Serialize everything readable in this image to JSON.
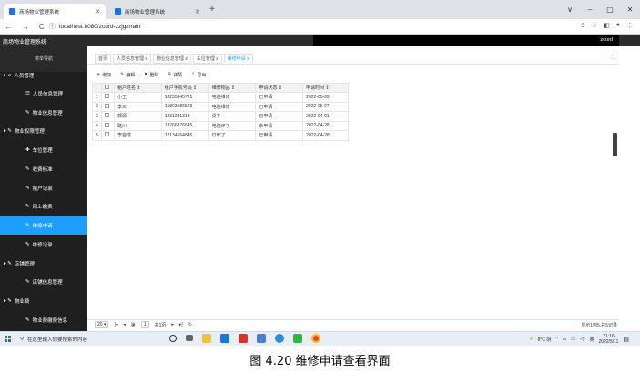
{
  "browser": {
    "tabs": [
      {
        "title": "商场物业管理系统"
      },
      {
        "title": "商场物业管理系统"
      }
    ],
    "new_tab": "+",
    "url_host": "localhost",
    "url_path": ":8080/zcurd-zzjg/main",
    "window_controls": [
      "∨",
      "–",
      "▢",
      "✕"
    ]
  },
  "app": {
    "title": "商场物业管理系统",
    "user": "zcurd"
  },
  "sidebar": {
    "title": "菜单导航",
    "items": [
      {
        "label": "人员管理",
        "icon": "♫",
        "level": "group"
      },
      {
        "label": "人员信息管理",
        "icon": "☰",
        "level": "sub"
      },
      {
        "label": "物业信息管理",
        "icon": "✎",
        "level": "sub"
      },
      {
        "label": "物业权限管理",
        "icon": "✎",
        "level": "group"
      },
      {
        "label": "车位管理",
        "icon": "✚",
        "level": "sub"
      },
      {
        "label": "收费标准",
        "icon": "✎",
        "level": "sub"
      },
      {
        "label": "租户记录",
        "icon": "✎",
        "level": "sub"
      },
      {
        "label": "网上缴费",
        "icon": "✎",
        "level": "sub"
      },
      {
        "label": "维修申请",
        "icon": "✎",
        "level": "sub",
        "active": true
      },
      {
        "label": "维修记录",
        "icon": "✎",
        "level": "sub"
      },
      {
        "label": "店铺管理",
        "icon": "✎",
        "level": "group"
      },
      {
        "label": "店铺信息管理",
        "icon": "✎",
        "level": "sub"
      },
      {
        "label": "物业费",
        "icon": "✎",
        "level": "group"
      },
      {
        "label": "物业费缴费信息",
        "icon": "✎",
        "level": "sub"
      }
    ]
  },
  "content_tabs": [
    {
      "label": "首页",
      "close": ""
    },
    {
      "label": "人员信息管理",
      "close": "x"
    },
    {
      "label": "物业信息管理",
      "close": "x"
    },
    {
      "label": "车位管理",
      "close": "x"
    },
    {
      "label": "维修申请",
      "close": "x",
      "active": true
    }
  ],
  "toolbar": {
    "add": "增加",
    "edit": "编辑",
    "delete": "删除",
    "detail": "详情",
    "export": "导出"
  },
  "table": {
    "columns": [
      "租户姓名",
      "租户手机号码",
      "维修物品",
      "申请状态",
      "申请时间"
    ],
    "rows": [
      {
        "no": "1",
        "name": "小王",
        "phone": "18235845721",
        "item": "电脑维修",
        "status": "已申请",
        "date": "2022-05-09"
      },
      {
        "no": "2",
        "name": "李三",
        "phone": "15803586523",
        "item": "电脑维修",
        "status": "已申请",
        "date": "2022-05-07"
      },
      {
        "no": "3",
        "name": "郭源",
        "phone": "1231231313",
        "item": "桌子",
        "status": "已申请",
        "date": "2022-04-01"
      },
      {
        "no": "4",
        "name": "路川",
        "phone": "13766876645",
        "item": "电脑坏了",
        "status": "未申请",
        "date": "2022-04-28"
      },
      {
        "no": "5",
        "name": "李自成",
        "phone": "12134564845",
        "item": "灯坏了",
        "status": "已申请",
        "date": "2022-04-28"
      }
    ]
  },
  "pager": {
    "page_size": "20",
    "page_label": "第",
    "page": "1",
    "total_pages": "共1页",
    "summary": "显示1到5,共5记录"
  },
  "taskbar": {
    "search_placeholder": "在这里输入你要搜索的内容",
    "weather": "8°C 阴",
    "ime": "英",
    "time": "21:16",
    "date": "2022/5/11"
  },
  "caption": "图 4.20 维修申请查看界面",
  "colors": {
    "sidebar_bg": "#1f1f1f",
    "active_blue": "#1e9fff",
    "header_bg": "#2b2b2b"
  }
}
